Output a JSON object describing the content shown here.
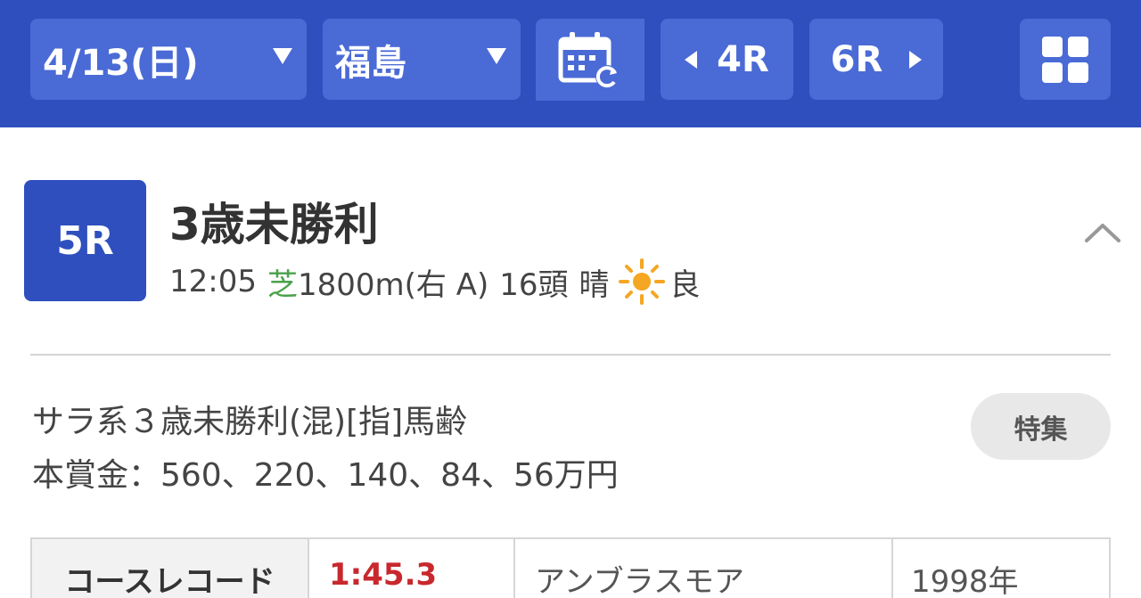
{
  "topbar": {
    "date_label": "4/13(日)",
    "venue_label": "福島",
    "prev_race_label": "4R",
    "next_race_label": "6R"
  },
  "race": {
    "number_label": "5R",
    "title": "3歳未勝利",
    "start_time": "12:05",
    "surface": "芝",
    "distance": "1800m(右 A)",
    "field_size": "16頭",
    "weather": "晴",
    "track_condition": "良",
    "conditions": "サラ系３歳未勝利(混)[指]馬齢",
    "prize": "本賞金：560、220、140、84、56万円",
    "feature_button_label": "特集"
  },
  "course_record": {
    "label": "コースレコード",
    "time": "1:45.3",
    "horse": "アンブラスモア",
    "year": "1998年"
  },
  "colors": {
    "brand_blue": "#2f4fbf",
    "turf_green": "#4aa14a",
    "record_red": "#c8282d",
    "sun_orange": "#f5a623"
  },
  "icons": {
    "calendar": "calendar-refresh-icon",
    "grid": "grid-menu-icon",
    "weather": "sun-icon",
    "collapse": "chevron-up-icon"
  }
}
